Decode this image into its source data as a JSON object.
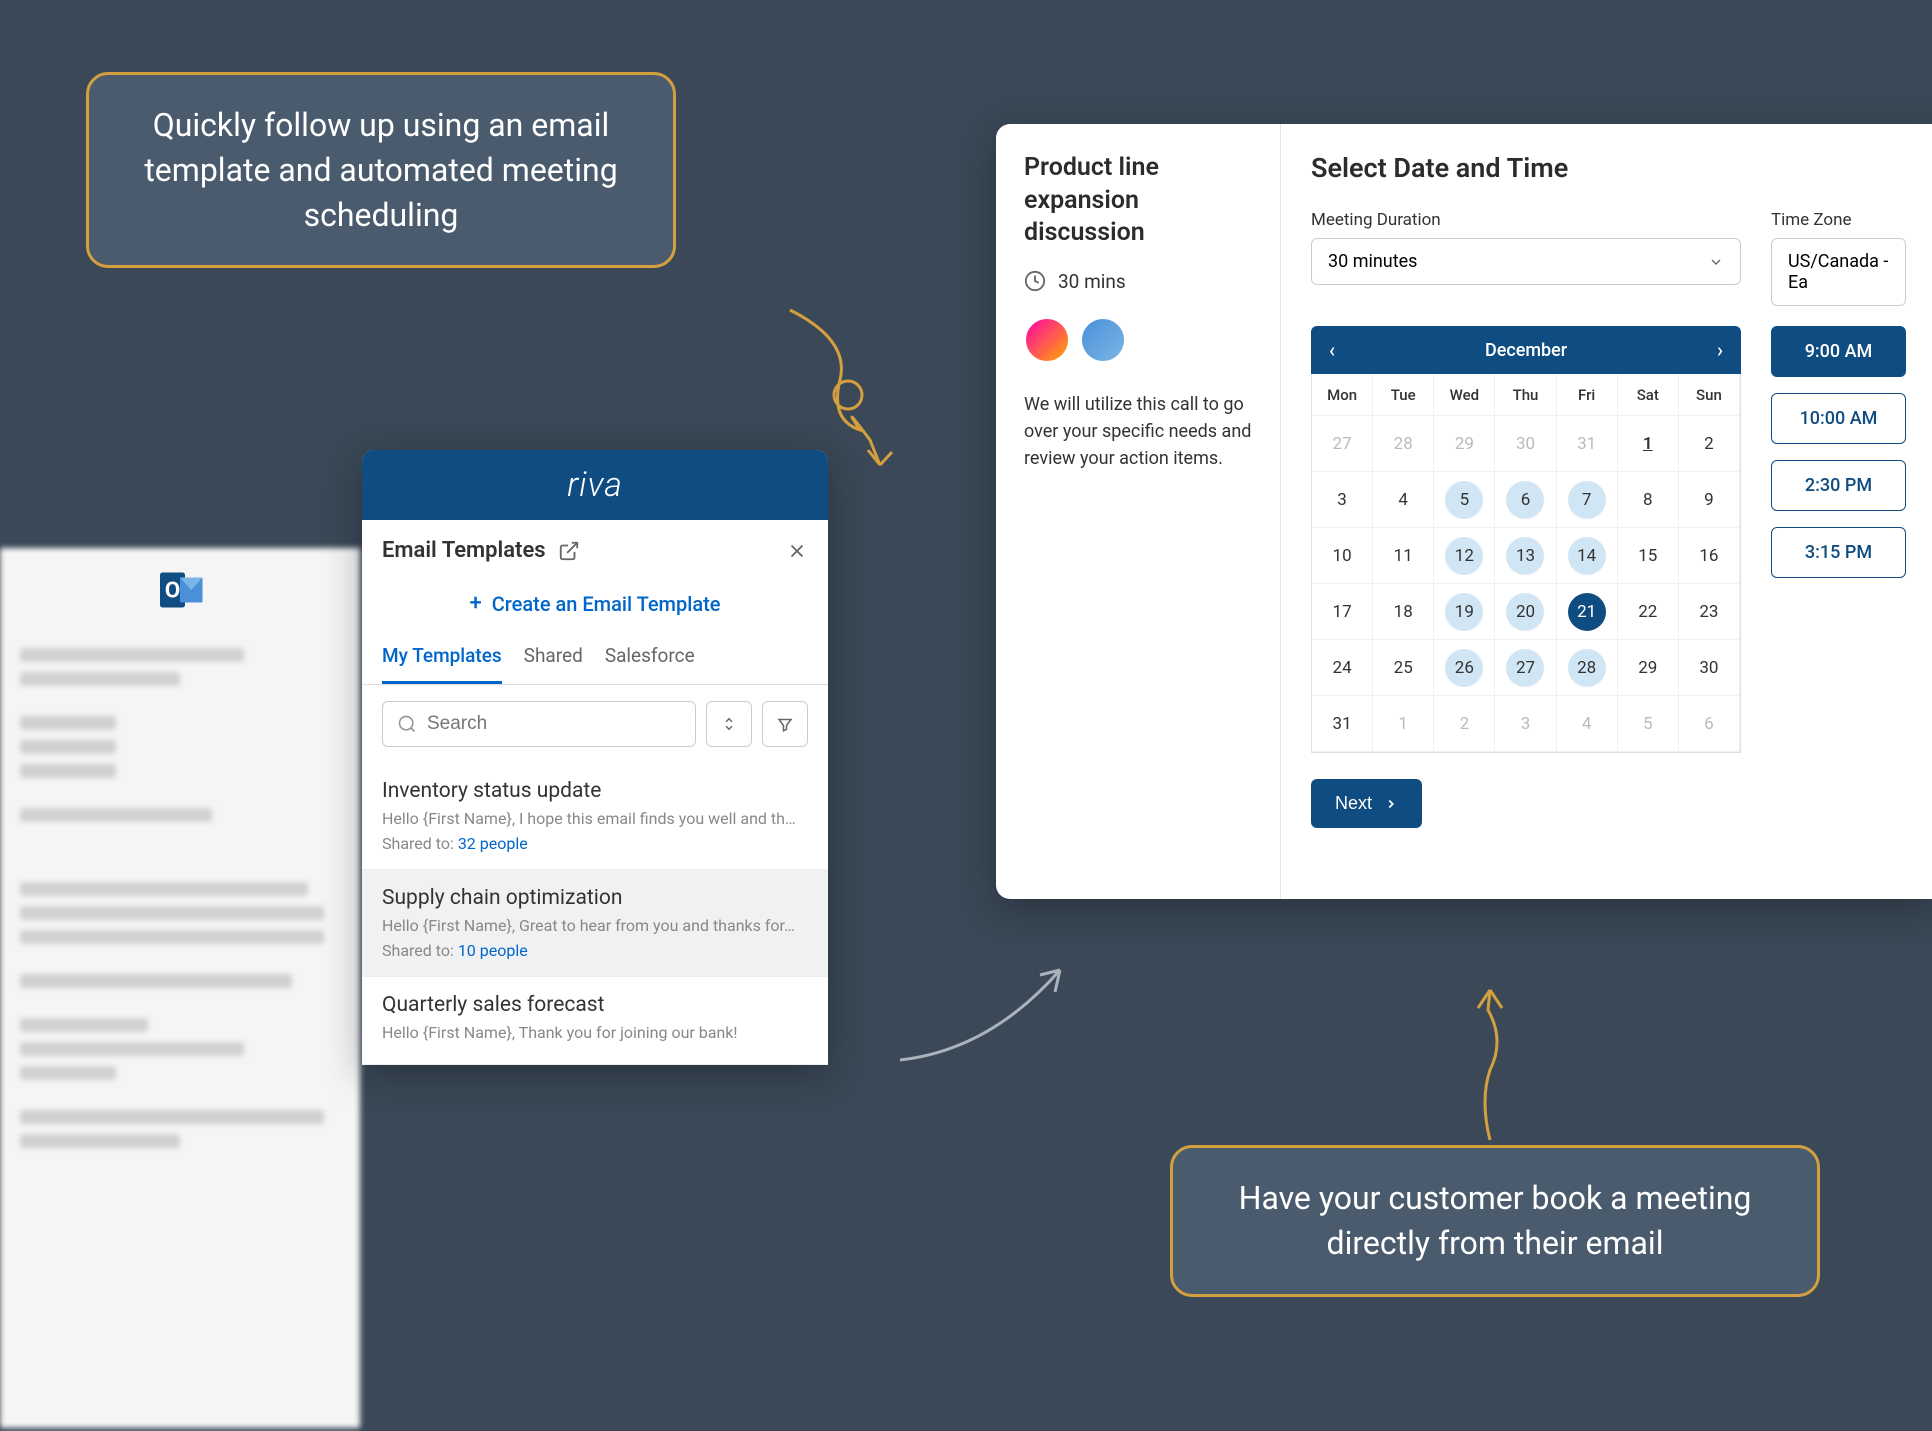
{
  "callouts": {
    "top": "Quickly follow up using an email template and automated meeting scheduling",
    "bottom": "Have your customer book a meeting directly from their email"
  },
  "riva": {
    "logo": "riva",
    "title": "Email Templates",
    "create_label": "Create an Email Template",
    "tabs": [
      "My Templates",
      "Shared",
      "Salesforce"
    ],
    "search_placeholder": "Search",
    "templates": [
      {
        "title": "Inventory status update",
        "preview": "Hello {First Name}, I hope this email finds you well and th…",
        "shared_prefix": "Shared to: ",
        "shared_count": "32 people"
      },
      {
        "title": "Supply chain optimization",
        "preview": "Hello {First Name}, Great to hear from you and thanks for…",
        "shared_prefix": "Shared to: ",
        "shared_count": "10 people"
      },
      {
        "title": "Quarterly sales forecast",
        "preview": "Hello {First Name}, Thank you for joining our bank!",
        "shared_prefix": "",
        "shared_count": ""
      }
    ]
  },
  "scheduler": {
    "meeting_title": "Product line expansion discussion",
    "duration": "30 mins",
    "description": "We will utilize this call to go over your specific needs and review your action items.",
    "heading": "Select Date and Time",
    "duration_label": "Meeting Duration",
    "duration_value": "30 minutes",
    "tz_label": "Time Zone",
    "tz_value": "US/Canada - Ea",
    "month": "December",
    "days": [
      "Mon",
      "Tue",
      "Wed",
      "Thu",
      "Fri",
      "Sat",
      "Sun"
    ],
    "weeks": [
      [
        {
          "d": "27",
          "m": 1
        },
        {
          "d": "28",
          "m": 1
        },
        {
          "d": "29",
          "m": 1
        },
        {
          "d": "30",
          "m": 1
        },
        {
          "d": "31",
          "m": 1
        },
        {
          "d": "1",
          "t": 1
        },
        {
          "d": "2"
        }
      ],
      [
        {
          "d": "3"
        },
        {
          "d": "4"
        },
        {
          "d": "5",
          "a": 1
        },
        {
          "d": "6",
          "a": 1
        },
        {
          "d": "7",
          "a": 1
        },
        {
          "d": "8"
        },
        {
          "d": "9"
        }
      ],
      [
        {
          "d": "10"
        },
        {
          "d": "11"
        },
        {
          "d": "12",
          "a": 1
        },
        {
          "d": "13",
          "a": 1
        },
        {
          "d": "14",
          "a": 1
        },
        {
          "d": "15"
        },
        {
          "d": "16"
        }
      ],
      [
        {
          "d": "17"
        },
        {
          "d": "18"
        },
        {
          "d": "19",
          "a": 1
        },
        {
          "d": "20",
          "a": 1
        },
        {
          "d": "21",
          "a": 1,
          "s": 1
        },
        {
          "d": "22"
        },
        {
          "d": "23"
        }
      ],
      [
        {
          "d": "24"
        },
        {
          "d": "25"
        },
        {
          "d": "26",
          "a": 1
        },
        {
          "d": "27",
          "a": 1
        },
        {
          "d": "28",
          "a": 1
        },
        {
          "d": "29"
        },
        {
          "d": "30"
        }
      ],
      [
        {
          "d": "31"
        },
        {
          "d": "1",
          "m": 1
        },
        {
          "d": "2",
          "m": 1
        },
        {
          "d": "3",
          "m": 1
        },
        {
          "d": "4",
          "m": 1
        },
        {
          "d": "5",
          "m": 1
        },
        {
          "d": "6",
          "m": 1
        }
      ]
    ],
    "time_slots": [
      {
        "t": "9:00 AM",
        "sel": true
      },
      {
        "t": "10:00 AM"
      },
      {
        "t": "2:30 PM"
      },
      {
        "t": "3:15 PM"
      }
    ],
    "next_label": "Next"
  }
}
